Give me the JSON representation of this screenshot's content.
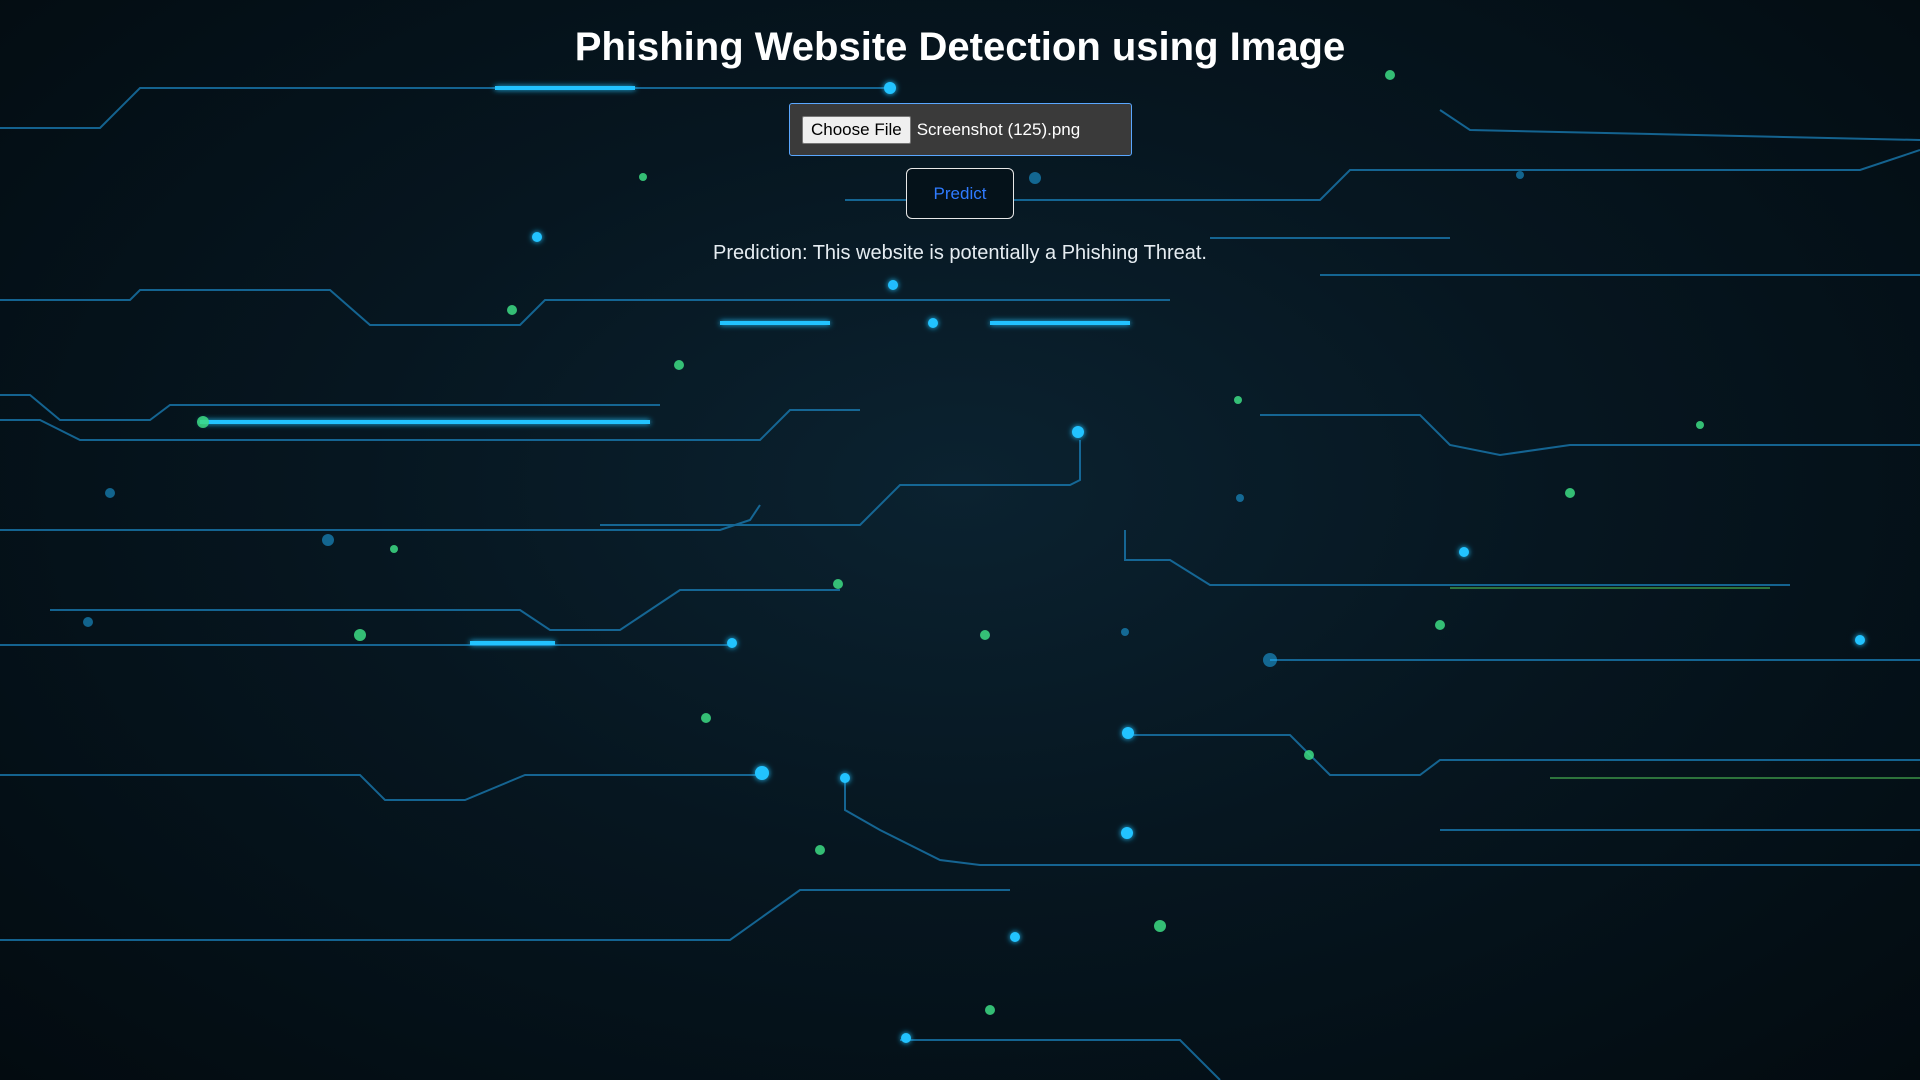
{
  "page": {
    "title": "Phishing Website Detection using Image"
  },
  "upload": {
    "choose_file_label": "Choose File",
    "selected_file": "Screenshot (125).png"
  },
  "actions": {
    "predict_label": "Predict"
  },
  "result": {
    "prediction_text": "Prediction: This website is potentially a Phishing Threat."
  },
  "theme": {
    "background": "#05121a",
    "circuit_blue": "#1fb6ff",
    "circuit_green": "#3ddc84",
    "predict_text": "#2f7bff",
    "file_border": "#5aa7ff"
  }
}
